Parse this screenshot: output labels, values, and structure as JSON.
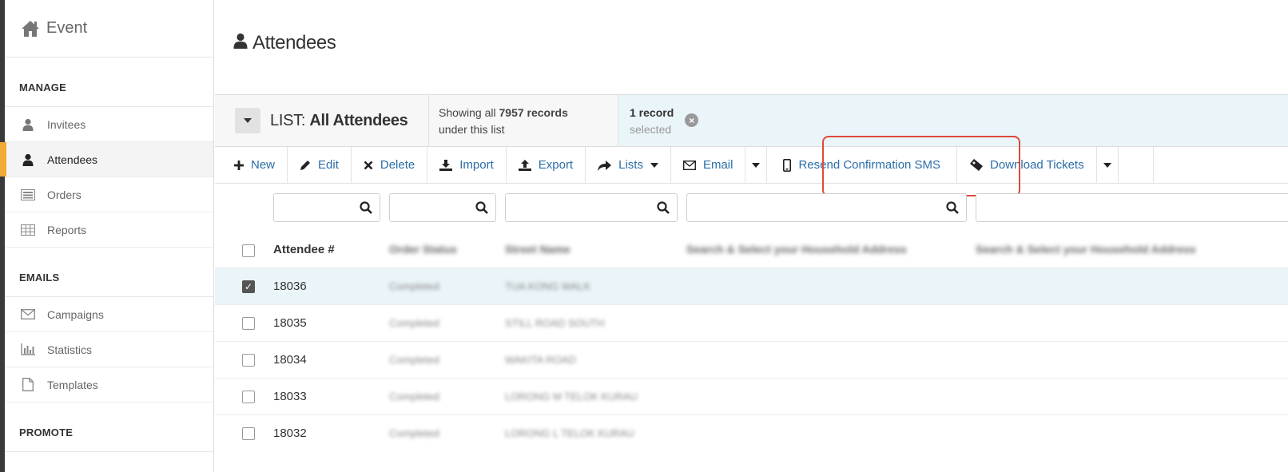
{
  "sidebar": {
    "brand": "Event",
    "sections": {
      "manage": "MANAGE",
      "emails": "EMAILS",
      "promote": "PROMOTE"
    },
    "manage_items": [
      {
        "label": "Invitees",
        "icon": "user-icon"
      },
      {
        "label": "Attendees",
        "icon": "user-icon",
        "active": true
      },
      {
        "label": "Orders",
        "icon": "orders-icon"
      },
      {
        "label": "Reports",
        "icon": "table-icon"
      }
    ],
    "email_items": [
      {
        "label": "Campaigns",
        "icon": "envelope-icon"
      },
      {
        "label": "Statistics",
        "icon": "bar-chart-icon"
      },
      {
        "label": "Templates",
        "icon": "document-icon"
      }
    ]
  },
  "page": {
    "title": "Attendees"
  },
  "list": {
    "prefix": "LIST:",
    "name": "All Attendees",
    "showing_prefix": "Showing all",
    "record_count": "7957 records",
    "under_list": "under this list",
    "selected_count": "1 record",
    "selected_label": "selected"
  },
  "toolbar": {
    "new": "New",
    "edit": "Edit",
    "delete": "Delete",
    "import": "Import",
    "export": "Export",
    "lists": "Lists",
    "email": "Email",
    "resend_sms": "Resend Confirmation SMS",
    "download_tickets": "Download Tickets"
  },
  "table": {
    "columns": {
      "attendee": "Attendee #",
      "order_status": "Order Status",
      "street_name": "Street Name",
      "household_1": "Search & Select your Household Address",
      "household_2": "Search & Select your Household Address"
    },
    "rows": [
      {
        "id": "18036",
        "status": "Completed",
        "street": "TUA KONG WALK",
        "checked": true
      },
      {
        "id": "18035",
        "status": "Completed",
        "street": "STILL ROAD SOUTH",
        "checked": false
      },
      {
        "id": "18034",
        "status": "Completed",
        "street": "WAKITA ROAD",
        "checked": false
      },
      {
        "id": "18033",
        "status": "Completed",
        "street": "LORONG M TELOK KURAU",
        "checked": false
      },
      {
        "id": "18032",
        "status": "Completed",
        "street": "LORONG L TELOK KURAU",
        "checked": false
      }
    ]
  },
  "colors": {
    "accent": "#f2a935",
    "link": "#2b6ea8",
    "highlight": "#e0493a",
    "selected_row": "#eaf5f9"
  }
}
